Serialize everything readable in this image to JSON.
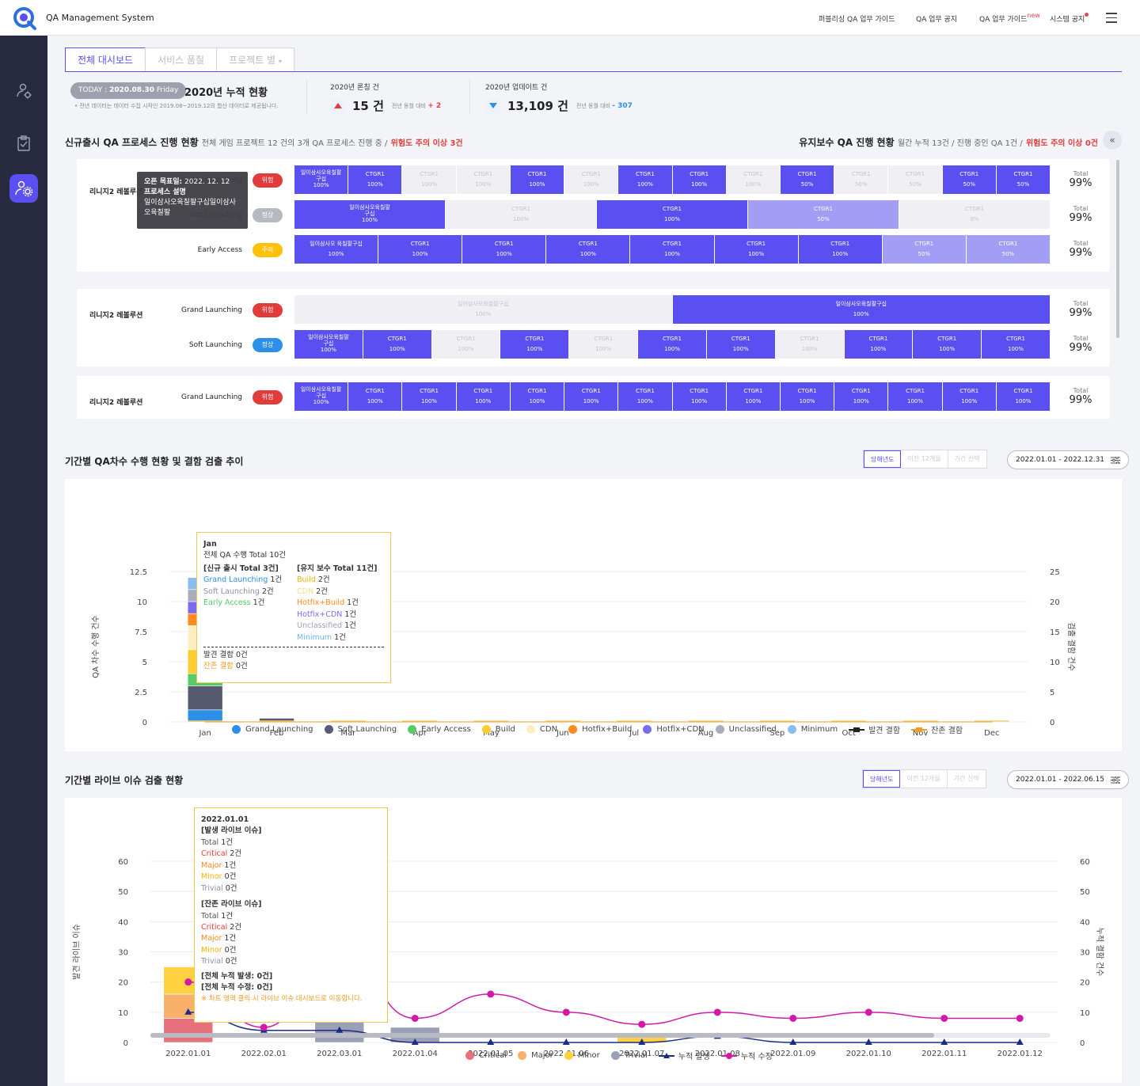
{
  "app": {
    "title": "QA Management System"
  },
  "topnav": {
    "items": [
      "퍼블리싱 QA 업무 가이드",
      "QA 업무 공지",
      "QA 업무 가이드",
      "시스템 공지"
    ],
    "new_badge": "new"
  },
  "tabs": [
    "전체 대시보드",
    "서비스 품질",
    "프로젝트 별"
  ],
  "summary": {
    "today_label": "TODAY :",
    "today_date": "2020.08.30",
    "today_day": "Friday",
    "title": "2020년 누적 현황",
    "note": "• 전년 데이터는 데이터 수집 시작인 2019.08~2019.12의 합산 데이터로 제공됩니다.",
    "launch": {
      "label": "2020년 론칭 건",
      "value": "15 건",
      "compare_label": "전년 동월 대비",
      "compare_value": "+ 2",
      "direction": "up"
    },
    "update": {
      "label": "2020년 업데이트 건",
      "value": "13,109 건",
      "compare_label": "전년 동월 대비",
      "compare_value": "- 307",
      "direction": "down"
    }
  },
  "new_release": {
    "title": "신규출시 QA 프로세스 진행 현황",
    "sub": "전체 게임 프로젝트 12 건의 3개 QA 프로세스 진행 중 /",
    "warn": "위험도 주의 이상 3건"
  },
  "maintenance": {
    "title": "유지보수 QA 진행 현황",
    "sub": "월간 누적 13건 / 진행 중인 QA 1건 /",
    "warn": "위험도 주의 이상 0건"
  },
  "tooltip_process": {
    "target_label": "오픈 목표일:",
    "target_date": "2022. 12. 12",
    "desc_label": "프로세스 설명",
    "desc": "일이삼사오육칠팔구십일이삼사오육칠팔"
  },
  "projects": [
    {
      "name": "리니지2 레볼루션",
      "rows": [
        {
          "stage": "Grand Launching",
          "status": "위험",
          "color": "red",
          "total_label": "Total",
          "total": "99%",
          "cells": [
            [
              "일이삼사오육칠팔구십",
              "100%",
              "full"
            ],
            [
              "CTGR1",
              "100%",
              "full"
            ],
            [
              "CTGR1",
              "100%",
              "empty"
            ],
            [
              "CTGR1",
              "100%",
              "empty"
            ],
            [
              "CTGR1",
              "100%",
              "full"
            ],
            [
              "CTGR1",
              "100%",
              "empty"
            ],
            [
              "CTGR1",
              "100%",
              "full"
            ],
            [
              "CTGR1",
              "100%",
              "full"
            ],
            [
              "CTGR1",
              "100%",
              "empty"
            ],
            [
              "CTGR1",
              "50%",
              "full"
            ],
            [
              "CTGR1",
              "50%",
              "empty"
            ],
            [
              "CTGR1",
              "50%",
              "empty"
            ],
            [
              "CTGR1",
              "50%",
              "full"
            ],
            [
              "CTGR1",
              "50%",
              "full"
            ]
          ]
        },
        {
          "stage": "Soft Launching",
          "status": "정상",
          "color": "gray",
          "total_label": "Total",
          "total": "99%",
          "cells": [
            [
              "일이삼사오육칠팔구십",
              "100%",
              "full"
            ],
            [
              "CTGR1",
              "100%",
              "empty"
            ],
            [
              "CTGR1",
              "100%",
              "full"
            ],
            [
              "CTGR1",
              "50%",
              "half"
            ],
            [
              "CTGR1",
              "0%",
              "empty"
            ]
          ]
        },
        {
          "stage": "Early Access",
          "status": "주의",
          "color": "yel",
          "total_label": "Total",
          "total": "99%",
          "cells": [
            [
              "일이삼사오 육칠팔구십",
              "100%",
              "full"
            ],
            [
              "CTGR1",
              "100%",
              "full"
            ],
            [
              "CTGR1",
              "100%",
              "full"
            ],
            [
              "CTGR1",
              "100%",
              "full"
            ],
            [
              "CTGR1",
              "100%",
              "full"
            ],
            [
              "CTGR1",
              "100%",
              "full"
            ],
            [
              "CTGR1",
              "100%",
              "full"
            ],
            [
              "CTGR1",
              "50%",
              "half"
            ],
            [
              "CTGR1",
              "50%",
              "half"
            ]
          ]
        }
      ]
    },
    {
      "name": "리니지2 레볼루션",
      "rows": [
        {
          "stage": "Grand Launching",
          "status": "위험",
          "color": "red",
          "total_label": "Total",
          "total": "99%",
          "cells": [
            [
              "일이삼사오육칠팔구십",
              "100%",
              "empty"
            ],
            [
              "일이삼사오육칠팔구십",
              "100%",
              "full"
            ]
          ]
        },
        {
          "stage": "Soft Launching",
          "status": "정상",
          "color": "blue",
          "total_label": "Total",
          "total": "99%",
          "cells": [
            [
              "일이삼사오육칠팔구십",
              "100%",
              "full"
            ],
            [
              "CTGR1",
              "100%",
              "full"
            ],
            [
              "CTGR1",
              "100%",
              "empty"
            ],
            [
              "CTGR1",
              "100%",
              "full"
            ],
            [
              "CTGR1",
              "100%",
              "empty"
            ],
            [
              "CTGR1",
              "100%",
              "full"
            ],
            [
              "CTGR1",
              "100%",
              "full"
            ],
            [
              "CTGR1",
              "100%",
              "empty"
            ],
            [
              "CTGR1",
              "100%",
              "full"
            ],
            [
              "CTGR1",
              "100%",
              "full"
            ],
            [
              "CTGR1",
              "100%",
              "full"
            ]
          ]
        }
      ]
    },
    {
      "name": "리니지2 레볼루션",
      "rows": [
        {
          "stage": "Grand Launching",
          "status": "위험",
          "color": "red",
          "total_label": "Total",
          "total": "99%",
          "cells": [
            [
              "일이삼사오육칠팔구십",
              "100%",
              "full"
            ],
            [
              "CTGR1",
              "100%",
              "full"
            ],
            [
              "CTGR1",
              "100%",
              "full"
            ],
            [
              "CTGR1",
              "100%",
              "full"
            ],
            [
              "CTGR1",
              "100%",
              "full"
            ],
            [
              "CTGR1",
              "100%",
              "full"
            ],
            [
              "CTGR1",
              "100%",
              "full"
            ],
            [
              "CTGR1",
              "100%",
              "full"
            ],
            [
              "CTGR1",
              "100%",
              "full"
            ],
            [
              "CTGR1",
              "100%",
              "full"
            ],
            [
              "CTGR1",
              "100%",
              "full"
            ],
            [
              "CTGR1",
              "100%",
              "full"
            ],
            [
              "CTGR1",
              "100%",
              "full"
            ],
            [
              "CTGR1",
              "100%",
              "full"
            ]
          ]
        }
      ]
    }
  ],
  "period_qa": {
    "title": "기간별 QA차수 수행 현황 및 결함 검출 추이",
    "filters": [
      "당해년도",
      "이전 12개월",
      "기간 선택"
    ],
    "range": "2022.01.01 - 2022.12.31"
  },
  "live_issue": {
    "title": "기간별 라이브 이슈 검출 현황",
    "filters": [
      "당해년도",
      "이전 12개월",
      "기간 선택"
    ],
    "range": "2022.01.01 - 2022.06.15"
  },
  "chart_data": [
    {
      "type": "bar",
      "ylabel": "QA 차수 수행 건수",
      "y2label": "검출 결함 건수",
      "ylim": [
        0,
        12.5
      ],
      "y2lim": [
        0,
        25
      ],
      "yticks": [
        "12.5",
        "10",
        "7.5",
        "5",
        "2.5",
        "0"
      ],
      "y2ticks": [
        "25",
        "20",
        "15",
        "10",
        "5",
        "0"
      ],
      "categories": [
        "Jan",
        "Feb",
        "Mar",
        "Apr",
        "May",
        "Jun",
        "Jul",
        "Aug",
        "Sep",
        "Oct",
        "Nov",
        "Dec"
      ],
      "series": [
        {
          "name": "Grand Launching",
          "color": "#2c8fe8",
          "values": [
            1,
            0,
            0,
            0,
            0,
            0,
            0,
            0,
            0,
            0,
            0,
            0
          ]
        },
        {
          "name": "Soft Launching",
          "color": "#565b72",
          "values": [
            2,
            0.3,
            0,
            0,
            0,
            0,
            0,
            0,
            0,
            0,
            0,
            0
          ]
        },
        {
          "name": "Early Access",
          "color": "#55cc66",
          "values": [
            1,
            0,
            0,
            0,
            0,
            0,
            0,
            0,
            0,
            0,
            0,
            0
          ]
        },
        {
          "name": "Build",
          "color": "#ffcc33",
          "values": [
            2,
            0,
            0,
            0,
            0,
            0,
            0,
            0,
            0,
            0,
            0,
            0
          ]
        },
        {
          "name": "CDN",
          "color": "#ffedc2",
          "values": [
            2,
            0,
            0,
            0,
            0,
            0,
            0,
            0,
            0,
            0,
            0,
            0
          ]
        },
        {
          "name": "Hotfix+Build",
          "color": "#ff8a1f",
          "values": [
            1,
            0,
            0,
            0,
            0,
            0,
            0,
            0,
            0,
            0,
            0,
            0
          ]
        },
        {
          "name": "Hotfix+CDN",
          "color": "#7a6cf0",
          "values": [
            1,
            0,
            0,
            0,
            0,
            0,
            0,
            0,
            0,
            0,
            0,
            0
          ]
        },
        {
          "name": "Unclassified",
          "color": "#a9acbc",
          "values": [
            1,
            0,
            0,
            0,
            0,
            0,
            0,
            0,
            0,
            0,
            0,
            0
          ]
        },
        {
          "name": "Minimum",
          "color": "#8bbcf0",
          "values": [
            1,
            0,
            0,
            0,
            0,
            0,
            0,
            0,
            0,
            0,
            0,
            0
          ]
        }
      ],
      "lines": [
        {
          "name": "발견 결함",
          "color": "#222",
          "values": [
            0,
            0,
            0,
            0,
            0,
            0,
            0,
            0,
            0,
            0,
            0,
            0
          ]
        },
        {
          "name": "잔존 결함",
          "color": "#f39a1f",
          "values": [
            0,
            0,
            0,
            0,
            0,
            0,
            0,
            0,
            0,
            0,
            0,
            0
          ]
        }
      ]
    },
    {
      "type": "bar",
      "ylabel": "발견 라이브 이슈",
      "y2label": "누적 결함 건수",
      "ylim": [
        0,
        60
      ],
      "y2lim": [
        0,
        60
      ],
      "yticks": [
        "60",
        "50",
        "40",
        "30",
        "20",
        "10",
        "0"
      ],
      "y2ticks": [
        "60",
        "50",
        "40",
        "30",
        "20",
        "10",
        "0"
      ],
      "categories": [
        "2022.01.01",
        "2022.02.01",
        "2022.03.01",
        "2022.01.04",
        "2022.01.05",
        "2022.01.06",
        "2022.01.07",
        "2022.01.08",
        "2022.01.09",
        "2022.01.10",
        "2022.01.11",
        "2022.01.12"
      ],
      "series": [
        {
          "name": "Critical",
          "color": "#e8707a",
          "values": [
            8,
            0,
            0,
            0,
            0,
            0,
            0,
            0,
            0,
            0,
            0,
            0
          ]
        },
        {
          "name": "Major",
          "color": "#f8b06a",
          "values": [
            8,
            0,
            0,
            0,
            0,
            0,
            0,
            0,
            0,
            0,
            0,
            0
          ]
        },
        {
          "name": "Minor",
          "color": "#ffd040",
          "values": [
            9,
            0,
            0,
            0,
            0,
            0,
            2.5,
            0,
            0,
            0,
            0,
            0
          ]
        },
        {
          "name": "Trivial",
          "color": "#9aa1b6",
          "values": [
            0,
            0,
            8.5,
            5,
            0,
            0,
            0,
            0,
            0,
            0,
            0,
            0
          ]
        }
      ],
      "lines": [
        {
          "name": "누적 발생",
          "color": "#1c2b8a",
          "values": [
            10,
            4,
            4,
            0,
            0,
            0,
            0,
            2,
            0,
            0,
            0,
            0
          ]
        },
        {
          "name": "누적 수정",
          "color": "#d11aa8",
          "values": [
            20,
            5,
            30,
            8,
            16,
            10,
            6,
            10,
            8,
            10,
            8,
            8
          ]
        }
      ]
    }
  ],
  "qa_tooltip": {
    "month": "Jan",
    "total": "전체 QA 수행 Total 10건",
    "new_header": "[신규 출시 Total 3건]",
    "maint_header": "[유지 보수 Total 11건]",
    "new_items": [
      [
        "Grand Launching",
        "1건",
        "#2c8fe8"
      ],
      [
        "Soft Launching",
        "2건",
        "#8a8fa6"
      ],
      [
        "Early Access",
        "1건",
        "#55cc66"
      ]
    ],
    "maint_items": [
      [
        "Build",
        "2건",
        "#f0b400"
      ],
      [
        "CDN",
        "2건",
        "#ffd98a"
      ],
      [
        "Hotfix+Build",
        "1건",
        "#ff8a1f"
      ],
      [
        "Hotfix+CDN",
        "1건",
        "#7a6cf0"
      ],
      [
        "Unclassified",
        "1건",
        "#9aa1b6"
      ],
      [
        "Minimum",
        "1건",
        "#72b3e8"
      ]
    ],
    "found": "발견 결함 0건",
    "remain_label": "잔존 결함",
    "remain_value": "0건"
  },
  "live_tooltip": {
    "date": "2022.01.01",
    "occur_header": "[발생 라이브 이슈]",
    "occur_items": [
      [
        "Total",
        "1건",
        "#555"
      ],
      [
        "Critical",
        "2건",
        "#e23b3b"
      ],
      [
        "Major",
        "1건",
        "#f08a1f"
      ],
      [
        "Minor",
        "0건",
        "#f0b400"
      ],
      [
        "Trivial",
        "0건",
        "#8a8fa6"
      ]
    ],
    "remain_header": "[잔존 라이브 이슈]",
    "remain_items": [
      [
        "Total",
        "1건",
        "#555"
      ],
      [
        "Critical",
        "2건",
        "#e23b3b"
      ],
      [
        "Major",
        "1건",
        "#f08a1f"
      ],
      [
        "Minor",
        "0건",
        "#f0b400"
      ],
      [
        "Trivial",
        "0건",
        "#8a8fa6"
      ]
    ],
    "cum_occur": "[전체 누적 발생: 0건]",
    "cum_fix": "[전체 누적 수정: 0건]",
    "hint": "※ 차트 영역 클릭 시 라이브 이슈 대시보드로 이동합니다."
  }
}
